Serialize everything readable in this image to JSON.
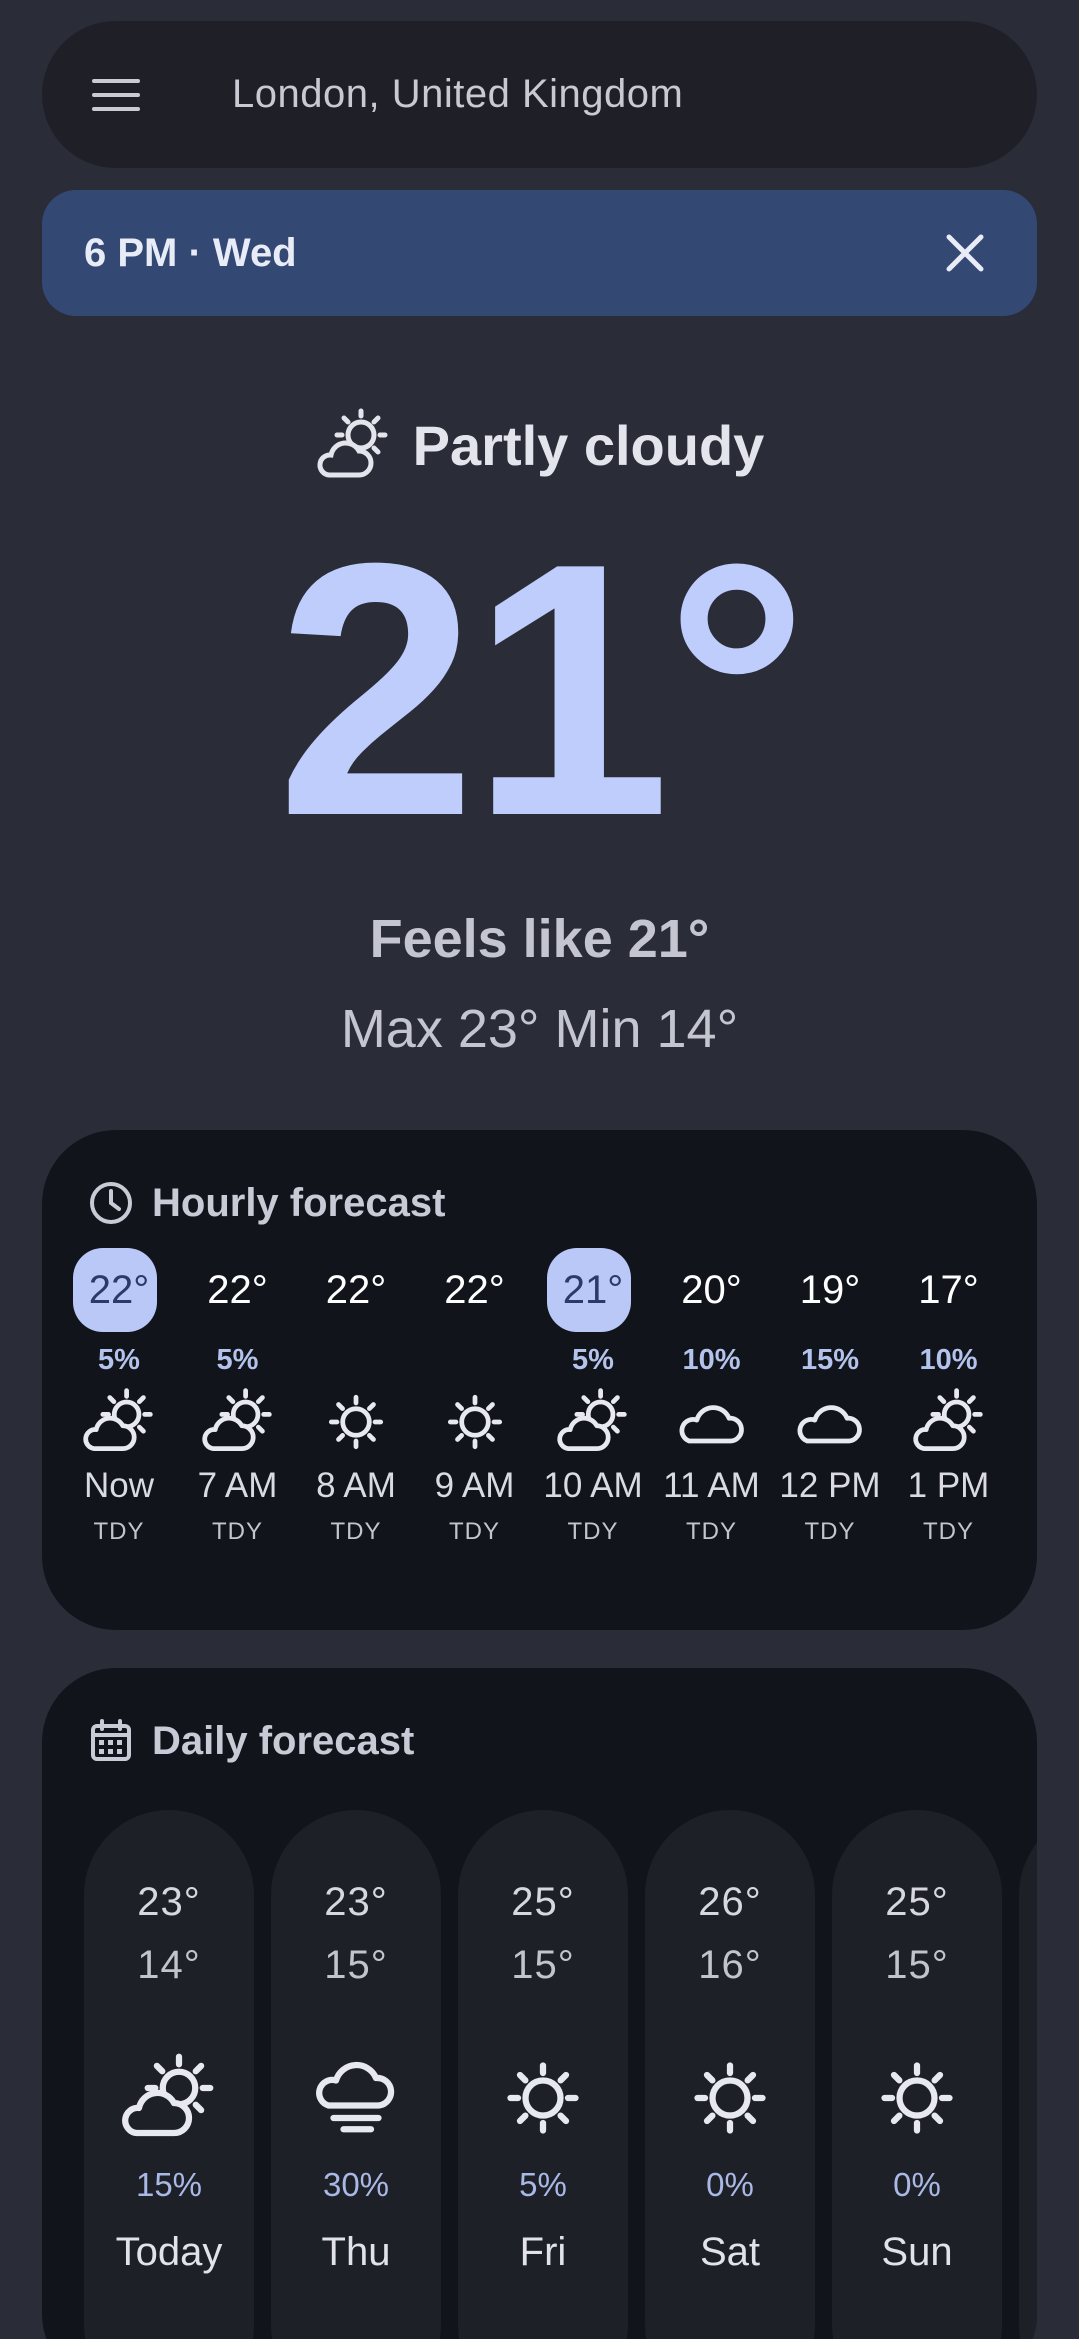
{
  "search": {
    "location": "London, United Kingdom"
  },
  "banner": {
    "time": "6 PM · Wed"
  },
  "current": {
    "condition": "Partly cloudy",
    "condition_icon": "partly-cloudy-icon",
    "temperature": "21°",
    "feels_like": "Feels like 21°",
    "max_min": "Max 23° Min 14°"
  },
  "hourly": {
    "title": "Hourly forecast",
    "items": [
      {
        "temp": "22°",
        "precip": "5%",
        "icon": "partly-cloudy",
        "label": "Now",
        "day": "TDY",
        "highlight": true
      },
      {
        "temp": "22°",
        "precip": "5%",
        "icon": "partly-cloudy",
        "label": "7 AM",
        "day": "TDY",
        "highlight": false
      },
      {
        "temp": "22°",
        "precip": "",
        "icon": "sunny",
        "label": "8 AM",
        "day": "TDY",
        "highlight": false
      },
      {
        "temp": "22°",
        "precip": "",
        "icon": "sunny",
        "label": "9 AM",
        "day": "TDY",
        "highlight": false
      },
      {
        "temp": "21°",
        "precip": "5%",
        "icon": "partly-cloudy",
        "label": "10 AM",
        "day": "TDY",
        "highlight": true
      },
      {
        "temp": "20°",
        "precip": "10%",
        "icon": "cloudy",
        "label": "11 AM",
        "day": "TDY",
        "highlight": false
      },
      {
        "temp": "19°",
        "precip": "15%",
        "icon": "cloudy",
        "label": "12 PM",
        "day": "TDY",
        "highlight": false
      },
      {
        "temp": "17°",
        "precip": "10%",
        "icon": "partly-cloudy",
        "label": "1 PM",
        "day": "TDY",
        "highlight": false
      }
    ]
  },
  "daily": {
    "title": "Daily forecast",
    "items": [
      {
        "max": "23°",
        "min": "14°",
        "icon": "partly-cloudy",
        "precip": "15%",
        "label": "Today"
      },
      {
        "max": "23°",
        "min": "15°",
        "icon": "cloudy-wind",
        "precip": "30%",
        "label": "Thu"
      },
      {
        "max": "25°",
        "min": "15°",
        "icon": "sunny",
        "precip": "5%",
        "label": "Fri"
      },
      {
        "max": "26°",
        "min": "16°",
        "icon": "sunny",
        "precip": "0%",
        "label": "Sat"
      },
      {
        "max": "25°",
        "min": "15°",
        "icon": "sunny",
        "precip": "0%",
        "label": "Sun"
      }
    ]
  },
  "colors": {
    "background": "#2a2c38",
    "accent_temp": "#bfcdfc",
    "banner": "#344874",
    "card": "#12141b",
    "highlight_chip": "#b9c8f6"
  }
}
